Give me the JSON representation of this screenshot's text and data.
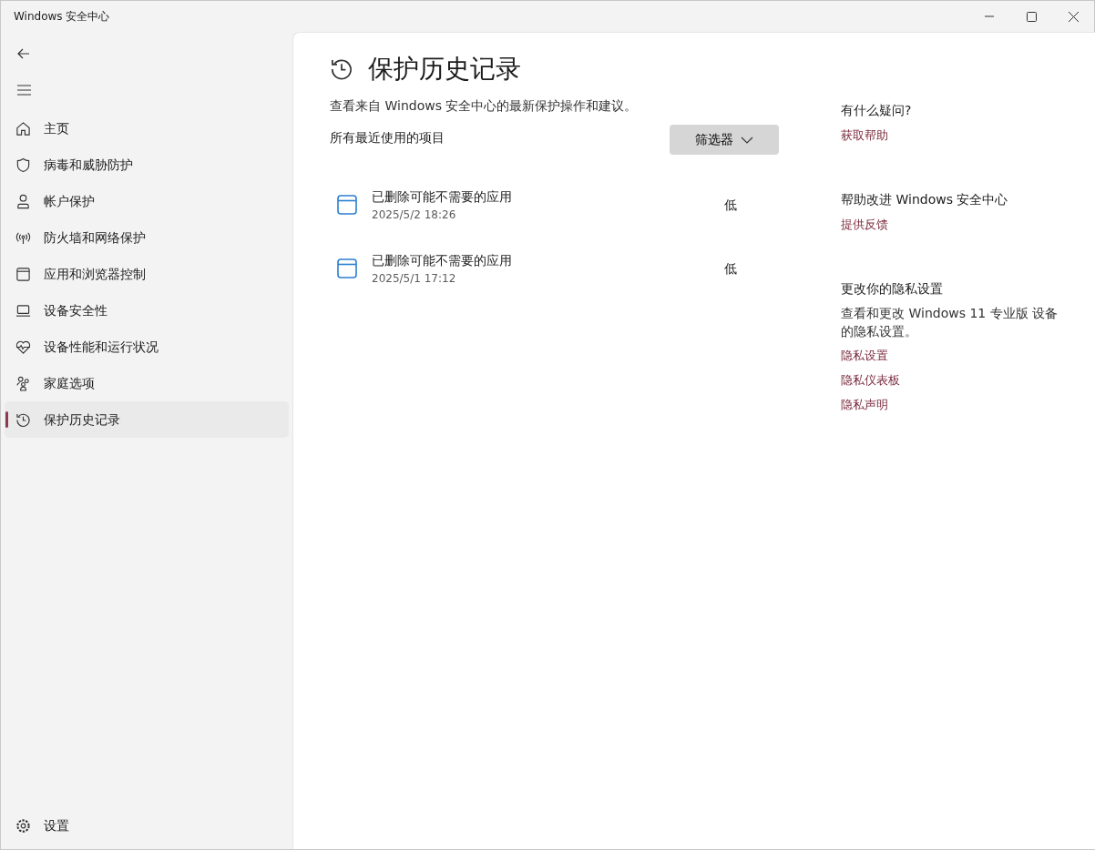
{
  "window": {
    "title": "Windows 安全中心"
  },
  "sidebar": {
    "items": [
      {
        "kind": "home",
        "label": "主页",
        "selected": false
      },
      {
        "kind": "shield",
        "label": "病毒和威胁防护",
        "selected": false
      },
      {
        "kind": "person",
        "label": "帐户保护",
        "selected": false
      },
      {
        "kind": "antenna",
        "label": "防火墙和网络保护",
        "selected": false
      },
      {
        "kind": "window",
        "label": "应用和浏览器控制",
        "selected": false
      },
      {
        "kind": "laptop",
        "label": "设备安全性",
        "selected": false
      },
      {
        "kind": "heart",
        "label": "设备性能和运行状况",
        "selected": false
      },
      {
        "kind": "family",
        "label": "家庭选项",
        "selected": false
      },
      {
        "kind": "history",
        "label": "保护历史记录",
        "selected": true
      }
    ],
    "settings": {
      "label": "设置"
    }
  },
  "page": {
    "title": "保护历史记录",
    "description": "查看来自 Windows 安全中心的最新保护操作和建议。",
    "section": "所有最近使用的项目",
    "filter_button": "筛选器",
    "entries": [
      {
        "title": "已删除可能不需要的应用",
        "time": "2025/5/2 18:26",
        "severity": "低"
      },
      {
        "title": "已删除可能不需要的应用",
        "time": "2025/5/1 17:12",
        "severity": "低"
      }
    ]
  },
  "aside": [
    {
      "heading": "有什么疑问?",
      "links": [
        "获取帮助"
      ]
    },
    {
      "heading": "帮助改进 Windows 安全中心",
      "links": [
        "提供反馈"
      ]
    },
    {
      "heading": "更改你的隐私设置",
      "text": "查看和更改 Windows 11 专业版 设备的隐私设置。",
      "links": [
        "隐私设置",
        "隐私仪表板",
        "隐私声明"
      ]
    }
  ]
}
